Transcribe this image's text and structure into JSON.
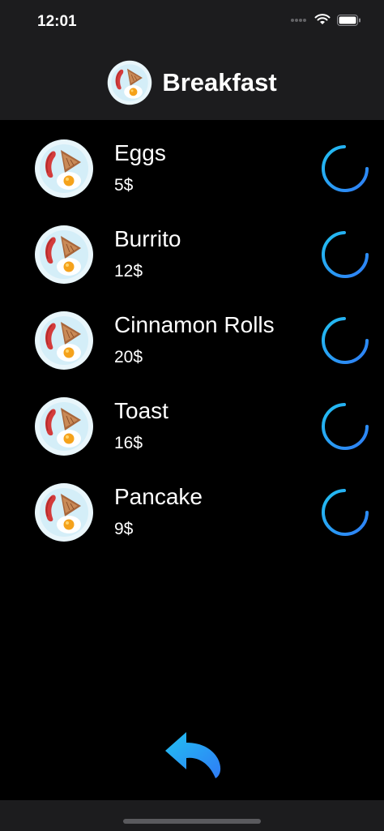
{
  "status_bar": {
    "time": "12:01"
  },
  "header": {
    "title": "Breakfast",
    "logo_icon": "breakfast-plate-icon"
  },
  "items": [
    {
      "name": "Eggs",
      "price": "5$"
    },
    {
      "name": "Burrito",
      "price": "12$"
    },
    {
      "name": "Cinnamon Rolls",
      "price": "20$"
    },
    {
      "name": "Toast",
      "price": "16$"
    },
    {
      "name": "Pancake",
      "price": "9$"
    }
  ],
  "icons": {
    "item": "breakfast-plate-icon",
    "add": "plus-circle-icon",
    "back": "back-arrow-icon"
  },
  "colors": {
    "background": "#000000",
    "bar": "#1c1c1e",
    "accent_start": "#1fb3ef",
    "accent_end": "#2f7cf6"
  }
}
